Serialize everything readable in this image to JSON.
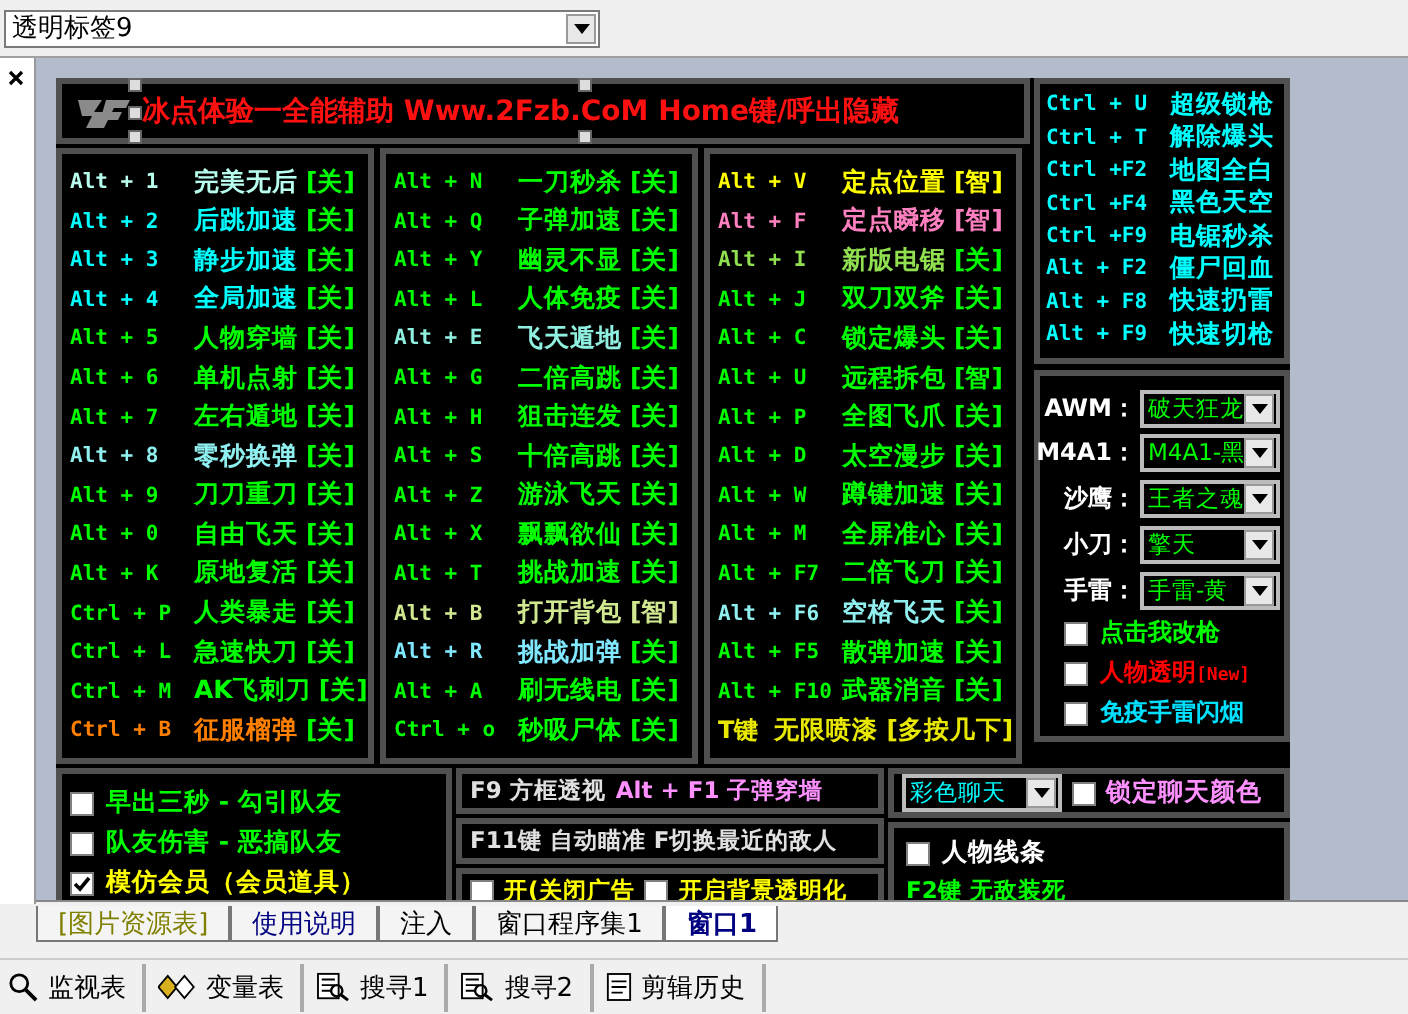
{
  "combo": {
    "value": "透明标签9"
  },
  "title": "冰点体验一全能辅助 Www.2Fzb.CoM Home键/呼出隐藏",
  "columns": [
    {
      "rows": [
        {
          "key": "Alt + 1",
          "name": "完美无后",
          "status": "[关]",
          "color": "#b8fff0",
          "smart": false
        },
        {
          "key": "Alt + 2",
          "name": "后跳加速",
          "status": "[关]",
          "color": "#00ffff",
          "smart": false
        },
        {
          "key": "Alt + 3",
          "name": "静步加速",
          "status": "[关]",
          "color": "#00ffff",
          "smart": false
        },
        {
          "key": "Alt + 4",
          "name": "全局加速",
          "status": "[关]",
          "color": "#00ffff",
          "smart": false
        },
        {
          "key": "Alt + 5",
          "name": "人物穿墙",
          "status": "[关]",
          "color": "#00ff00",
          "smart": false
        },
        {
          "key": "Alt + 6",
          "name": "单机点射",
          "status": "[关]",
          "color": "#00ff00",
          "smart": false
        },
        {
          "key": "Alt + 7",
          "name": "左右遁地",
          "status": "[关]",
          "color": "#00ff00",
          "smart": false
        },
        {
          "key": "Alt + 8",
          "name": "零秒换弹",
          "status": "[关]",
          "color": "#90f0f0",
          "smart": false
        },
        {
          "key": "Alt + 9",
          "name": "刀刀重刀",
          "status": "[关]",
          "color": "#00ff00",
          "smart": false
        },
        {
          "key": "Alt + 0",
          "name": "自由飞天",
          "status": "[关]",
          "color": "#00ff00",
          "smart": false
        },
        {
          "key": "Alt + K",
          "name": "原地复活",
          "status": "[关]",
          "color": "#00ff00",
          "smart": false
        },
        {
          "key": "Ctrl + P",
          "name": "人类暴走",
          "status": "[关]",
          "color": "#00ff00",
          "smart": false
        },
        {
          "key": "Ctrl + L",
          "name": "急速快刀",
          "status": "[关]",
          "color": "#00ff00",
          "smart": false
        },
        {
          "key": "Ctrl + M",
          "name": "AK飞刺刀",
          "status": "[关]",
          "color": "#00ff00",
          "smart": false
        },
        {
          "key": "Ctrl + B",
          "name": "征服榴弹",
          "status": "[关]",
          "color": "#ff8000",
          "smart": false
        }
      ]
    },
    {
      "rows": [
        {
          "key": "Alt + N",
          "name": "一刀秒杀",
          "status": "[关]",
          "color": "#00ff00",
          "smart": false
        },
        {
          "key": "Alt + Q",
          "name": "子弹加速",
          "status": "[关]",
          "color": "#00ff00",
          "smart": false
        },
        {
          "key": "Alt + Y",
          "name": "幽灵不显",
          "status": "[关]",
          "color": "#00ff00",
          "smart": false
        },
        {
          "key": "Alt + L",
          "name": "人体免疫",
          "status": "[关]",
          "color": "#00ff00",
          "smart": false
        },
        {
          "key": "Alt + E",
          "name": "飞天遁地",
          "status": "[关]",
          "color": "#90f0e0",
          "smart": false
        },
        {
          "key": "Alt + G",
          "name": "二倍高跳",
          "status": "[关]",
          "color": "#00ff00",
          "smart": false
        },
        {
          "key": "Alt + H",
          "name": "狙击连发",
          "status": "[关]",
          "color": "#00ff00",
          "smart": false
        },
        {
          "key": "Alt + S",
          "name": "十倍高跳",
          "status": "[关]",
          "color": "#00ff00",
          "smart": false
        },
        {
          "key": "Alt + Z",
          "name": "游泳飞天",
          "status": "[关]",
          "color": "#00ff00",
          "smart": false
        },
        {
          "key": "Alt + X",
          "name": "飘飘欲仙",
          "status": "[关]",
          "color": "#00ff00",
          "smart": false
        },
        {
          "key": "Alt + T",
          "name": "挑战加速",
          "status": "[关]",
          "color": "#00ff00",
          "smart": false
        },
        {
          "key": "Alt + B",
          "name": "打开背包",
          "status": "[智]",
          "color": "#d0e890",
          "smart": true
        },
        {
          "key": "Alt + R",
          "name": "挑战加弹",
          "status": "[关]",
          "color": "#80e8ff",
          "smart": false
        },
        {
          "key": "Alt + A",
          "name": "刷无线电",
          "status": "[关]",
          "color": "#00ff00",
          "smart": false
        },
        {
          "key": "Ctrl + o",
          "name": "秒吸尸体",
          "status": "[关]",
          "color": "#00ff00",
          "smart": false
        }
      ]
    },
    {
      "rows": [
        {
          "key": "Alt + V",
          "name": "定点位置",
          "status": "[智]",
          "color": "#ffff00",
          "smart": true
        },
        {
          "key": "Alt + F",
          "name": "定点瞬移",
          "status": "[智]",
          "color": "#ff80c0",
          "smart": true
        },
        {
          "key": "Alt + I",
          "name": "新版电锯",
          "status": "[关]",
          "color": "#90e050",
          "smart": false
        },
        {
          "key": "Alt + J",
          "name": "双刀双斧",
          "status": "[关]",
          "color": "#00ff00",
          "smart": false
        },
        {
          "key": "Alt + C",
          "name": "锁定爆头",
          "status": "[关]",
          "color": "#00ff00",
          "smart": false
        },
        {
          "key": "Alt + U",
          "name": "远程拆包",
          "status": "[智]",
          "color": "#00ff00"
        },
        {
          "key": "Alt + P",
          "name": "全图飞爪",
          "status": "[关]",
          "color": "#00ff00",
          "smart": false
        },
        {
          "key": "Alt + D",
          "name": "太空漫步",
          "status": "[关]",
          "color": "#00ff00",
          "smart": false
        },
        {
          "key": "Alt + W",
          "name": "蹲键加速",
          "status": "[关]",
          "color": "#00ff00",
          "smart": false
        },
        {
          "key": "Alt + M",
          "name": "全屏准心",
          "status": "[关]",
          "color": "#00ff00",
          "smart": false
        },
        {
          "key": "Alt + F7",
          "name": "二倍飞刀",
          "status": "[关]",
          "color": "#00ff00",
          "smart": false
        },
        {
          "key": "Alt + F6",
          "name": "空格飞天",
          "status": "[关]",
          "color": "#90f0f0",
          "smart": false
        },
        {
          "key": "Alt + F5",
          "name": "散弹加速",
          "status": "[关]",
          "color": "#00ff00",
          "smart": false
        },
        {
          "key": "Alt + F10",
          "name": "武器消音",
          "status": "[关]",
          "color": "#00ff00",
          "smart": false
        }
      ],
      "footer": {
        "key": "T键",
        "name": "无限喷漆",
        "status": "[多按几下]",
        "color": "#e8e800"
      }
    }
  ],
  "hotkeys": [
    {
      "key": "Ctrl + U",
      "name": "超级锁枪"
    },
    {
      "key": "Ctrl + T",
      "name": "解除爆头"
    },
    {
      "key": "Ctrl +F2",
      "name": "地图全白"
    },
    {
      "key": "Ctrl +F4",
      "name": "黑色天空"
    },
    {
      "key": "Ctrl +F9",
      "name": "电锯秒杀"
    },
    {
      "key": "Alt + F2",
      "name": "僵尸回血"
    },
    {
      "key": "Alt + F8",
      "name": "快速扔雷"
    },
    {
      "key": "Alt + F9",
      "name": "快速切枪"
    }
  ],
  "weapons": [
    {
      "label": "AWM：",
      "value": "破天狂龙"
    },
    {
      "label": "M4A1：",
      "value": "M4A1-黑"
    },
    {
      "label": "沙鹰：",
      "value": "王者之魂"
    },
    {
      "label": "小刀：",
      "value": "擎天"
    },
    {
      "label": "手雷：",
      "value": "手雷-黄"
    }
  ],
  "weapon_options": [
    {
      "label": "点击我改枪",
      "checked": false,
      "color": "#00ff00"
    },
    {
      "label": "人物透明",
      "badge": "[New]",
      "checked": false,
      "color": "#ff0000"
    },
    {
      "label": "免疫手雷闪烟",
      "checked": false,
      "color": "#00e0ff"
    }
  ],
  "extras": [
    {
      "label": "早出三秒 - 勾引队友",
      "checked": false,
      "color": "#00ff00"
    },
    {
      "label": "队友伤害 - 恶搞队友",
      "checked": false,
      "color": "#00ff00"
    },
    {
      "label": "模仿会员（会员道具）",
      "checked": true,
      "color": "#ffff00"
    }
  ],
  "info_lines": [
    {
      "text": "F9 方框透视",
      "extra": "Alt + F1 子弹穿墙"
    },
    {
      "text": "F11键 自动瞄准 F切换最近的敌人"
    }
  ],
  "toggles": [
    {
      "label": "开(关闭广告",
      "checked": false
    },
    {
      "label": "开启背景透明化",
      "checked": false
    }
  ],
  "chat": {
    "value": "彩色聊天",
    "lock_label": "锁定聊天颜色",
    "lock_checked": false
  },
  "line_option": {
    "label": "人物线条",
    "checked": false
  },
  "god_key": "F2键 无敌装死",
  "tabs": [
    {
      "label": "[图片资源表]",
      "selected": false
    },
    {
      "label": "使用说明",
      "selected": false
    },
    {
      "label": "注入",
      "selected": false
    },
    {
      "label": "窗口程序集1",
      "selected": false
    },
    {
      "label": "窗口1",
      "selected": true
    }
  ],
  "tools": [
    {
      "label": "监视表",
      "kind": "watch"
    },
    {
      "label": "变量表",
      "kind": "vars"
    },
    {
      "label": "搜寻1",
      "kind": "search"
    },
    {
      "label": "搜寻2",
      "kind": "search"
    },
    {
      "label": "剪辑历史",
      "kind": "clip"
    }
  ]
}
